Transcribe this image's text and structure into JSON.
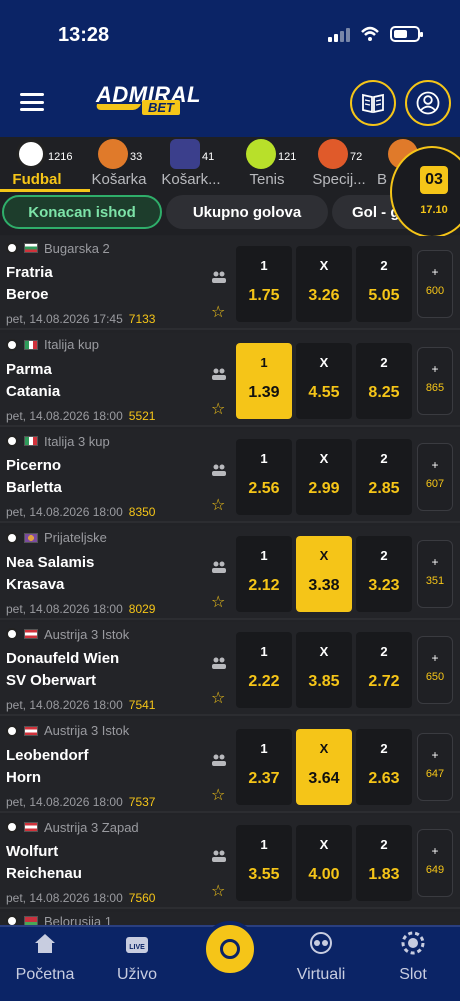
{
  "status": {
    "time": "13:28"
  },
  "header": {
    "logo_top": "ADMIRAL",
    "logo_bottom": "BET"
  },
  "sports": [
    {
      "label": "Fudbal",
      "count": "1216",
      "color": "#ffffff"
    },
    {
      "label": "Košarka",
      "count": "33",
      "color": "#e07a2a"
    },
    {
      "label": "Košark...",
      "count": "41",
      "color": "#3b3f8c"
    },
    {
      "label": "Tenis",
      "count": "121",
      "color": "#b8e02a"
    },
    {
      "label": "Specij...",
      "count": "72",
      "color": "#e05a2a"
    },
    {
      "label": "B",
      "count": "",
      "color": "#e07a2a"
    }
  ],
  "live": {
    "box": "03",
    "time": "17.10"
  },
  "tabs": [
    "Konacan ishod",
    "Ukupno golova",
    "Gol - g"
  ],
  "matches": [
    {
      "league": "Bugarska 2",
      "home": "Fratria",
      "away": "Beroe",
      "date": "pet, 14.08.2026 17:45",
      "code": "7133",
      "odds": [
        "1.75",
        "3.26",
        "5.05"
      ],
      "more": "600",
      "selected": ""
    },
    {
      "league": "Italija kup",
      "home": "Parma",
      "away": "Catania",
      "date": "pet, 14.08.2026 18:00",
      "code": "5521",
      "odds": [
        "1.39",
        "4.55",
        "8.25"
      ],
      "more": "865",
      "selected": "1"
    },
    {
      "league": "Italija 3 kup",
      "home": "Picerno",
      "away": "Barletta",
      "date": "pet, 14.08.2026 18:00",
      "code": "8350",
      "odds": [
        "2.56",
        "2.99",
        "2.85"
      ],
      "more": "607",
      "selected": ""
    },
    {
      "league": "Prijateljske",
      "home": "Nea Salamis",
      "away": "Krasava",
      "date": "pet, 14.08.2026 18:00",
      "code": "8029",
      "odds": [
        "2.12",
        "3.38",
        "3.23"
      ],
      "more": "351",
      "selected": "X"
    },
    {
      "league": "Austrija 3 Istok",
      "home": "Donaufeld Wien",
      "away": "SV Oberwart",
      "date": "pet, 14.08.2026 18:00",
      "code": "7541",
      "odds": [
        "2.22",
        "3.85",
        "2.72"
      ],
      "more": "650",
      "selected": ""
    },
    {
      "league": "Austrija 3 Istok",
      "home": "Leobendorf",
      "away": "Horn",
      "date": "pet, 14.08.2026 18:00",
      "code": "7537",
      "odds": [
        "2.37",
        "3.64",
        "2.63"
      ],
      "more": "647",
      "selected": "X"
    },
    {
      "league": "Austrija 3 Zapad",
      "home": "Wolfurt",
      "away": "Reichenau",
      "date": "pet, 14.08.2026 18:00",
      "code": "7560",
      "odds": [
        "3.55",
        "4.00",
        "1.83"
      ],
      "more": "649",
      "selected": ""
    }
  ],
  "partial_league": "Belorusija 1",
  "odd_labels": [
    "1",
    "X",
    "2"
  ],
  "more_plus": "+",
  "bottom_nav": [
    "Početna",
    "Uživo",
    "Virtuali",
    "Slot"
  ],
  "colors": {
    "accent": "#f5c518",
    "header": "#0b2466",
    "active_tab": "#2fae6a"
  }
}
